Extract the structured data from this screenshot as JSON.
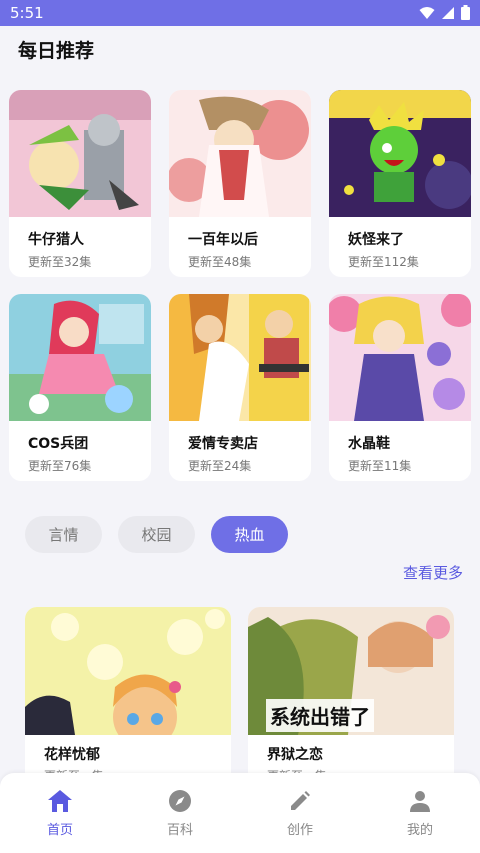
{
  "status": {
    "time": "5:51"
  },
  "page_title": "每日推荐",
  "cards": [
    {
      "title": "牛仔猎人",
      "sub": "更新至32集"
    },
    {
      "title": "一百年以后",
      "sub": "更新至48集"
    },
    {
      "title": "妖怪来了",
      "sub": "更新至112集"
    },
    {
      "title": "COS兵团",
      "sub": "更新至76集"
    },
    {
      "title": "爱情专卖店",
      "sub": "更新至24集"
    },
    {
      "title": "水晶鞋",
      "sub": "更新至11集"
    }
  ],
  "chips": [
    "言情",
    "校园",
    "热血"
  ],
  "see_more": "查看更多",
  "wide_cards": [
    {
      "title": "花样忧郁",
      "sub": "更新至...集"
    },
    {
      "title": "界狱之恋",
      "sub": "更新至...集",
      "overlay": "系统出错了"
    }
  ],
  "tabs": [
    {
      "label": "首页",
      "icon": "home-icon"
    },
    {
      "label": "百科",
      "icon": "compass-icon"
    },
    {
      "label": "创作",
      "icon": "pencil-icon"
    },
    {
      "label": "我的",
      "icon": "person-icon"
    }
  ],
  "colors": {
    "accent": "#6f6fe6",
    "link": "#5a5ae0"
  }
}
